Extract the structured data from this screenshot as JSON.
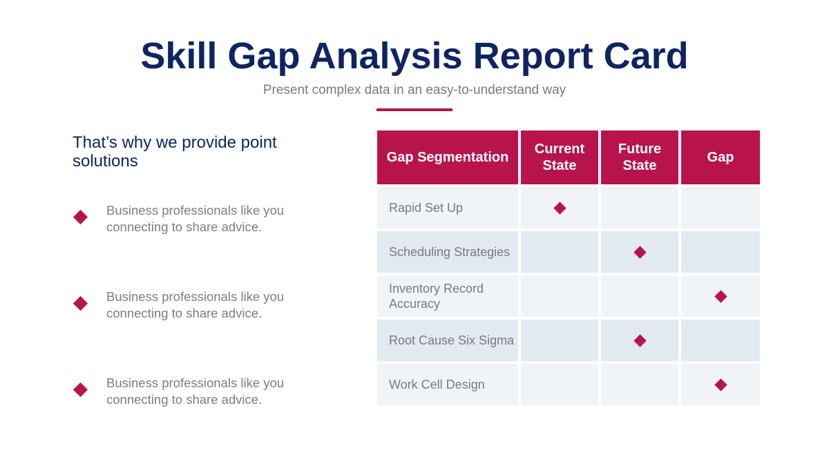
{
  "header": {
    "title": "Skill Gap Analysis Report Card",
    "subtitle": "Present complex data in an easy-to-understand way"
  },
  "left": {
    "heading": "That’s why we provide point solutions",
    "bullets": [
      {
        "icon": "diamond-bullet-icon",
        "text": "Business professionals like you connecting to share advice."
      },
      {
        "icon": "diamond-bullet-icon",
        "text": "Business professionals like you connecting to share advice."
      },
      {
        "icon": "diamond-bullet-icon",
        "text": "Business professionals like you connecting to share advice."
      }
    ]
  },
  "table": {
    "headers": [
      "Gap Segmentation",
      "Current State",
      "Future State",
      "Gap"
    ],
    "rows": [
      {
        "label": "Rapid Set Up",
        "marks": [
          true,
          false,
          false
        ]
      },
      {
        "label": "Scheduling Strategies",
        "marks": [
          false,
          true,
          false
        ]
      },
      {
        "label": "Inventory Record Accuracy",
        "marks": [
          false,
          false,
          true
        ]
      },
      {
        "label": "Root Cause Six Sigma",
        "marks": [
          false,
          true,
          false
        ]
      },
      {
        "label": "Work Cell Design",
        "marks": [
          false,
          false,
          true
        ]
      }
    ]
  },
  "colors": {
    "accent": "#b8144b",
    "title": "#0f2462",
    "body_text": "#7a7a7a",
    "row_light": "#f0f4f7",
    "row_dark": "#e2e9f0"
  }
}
